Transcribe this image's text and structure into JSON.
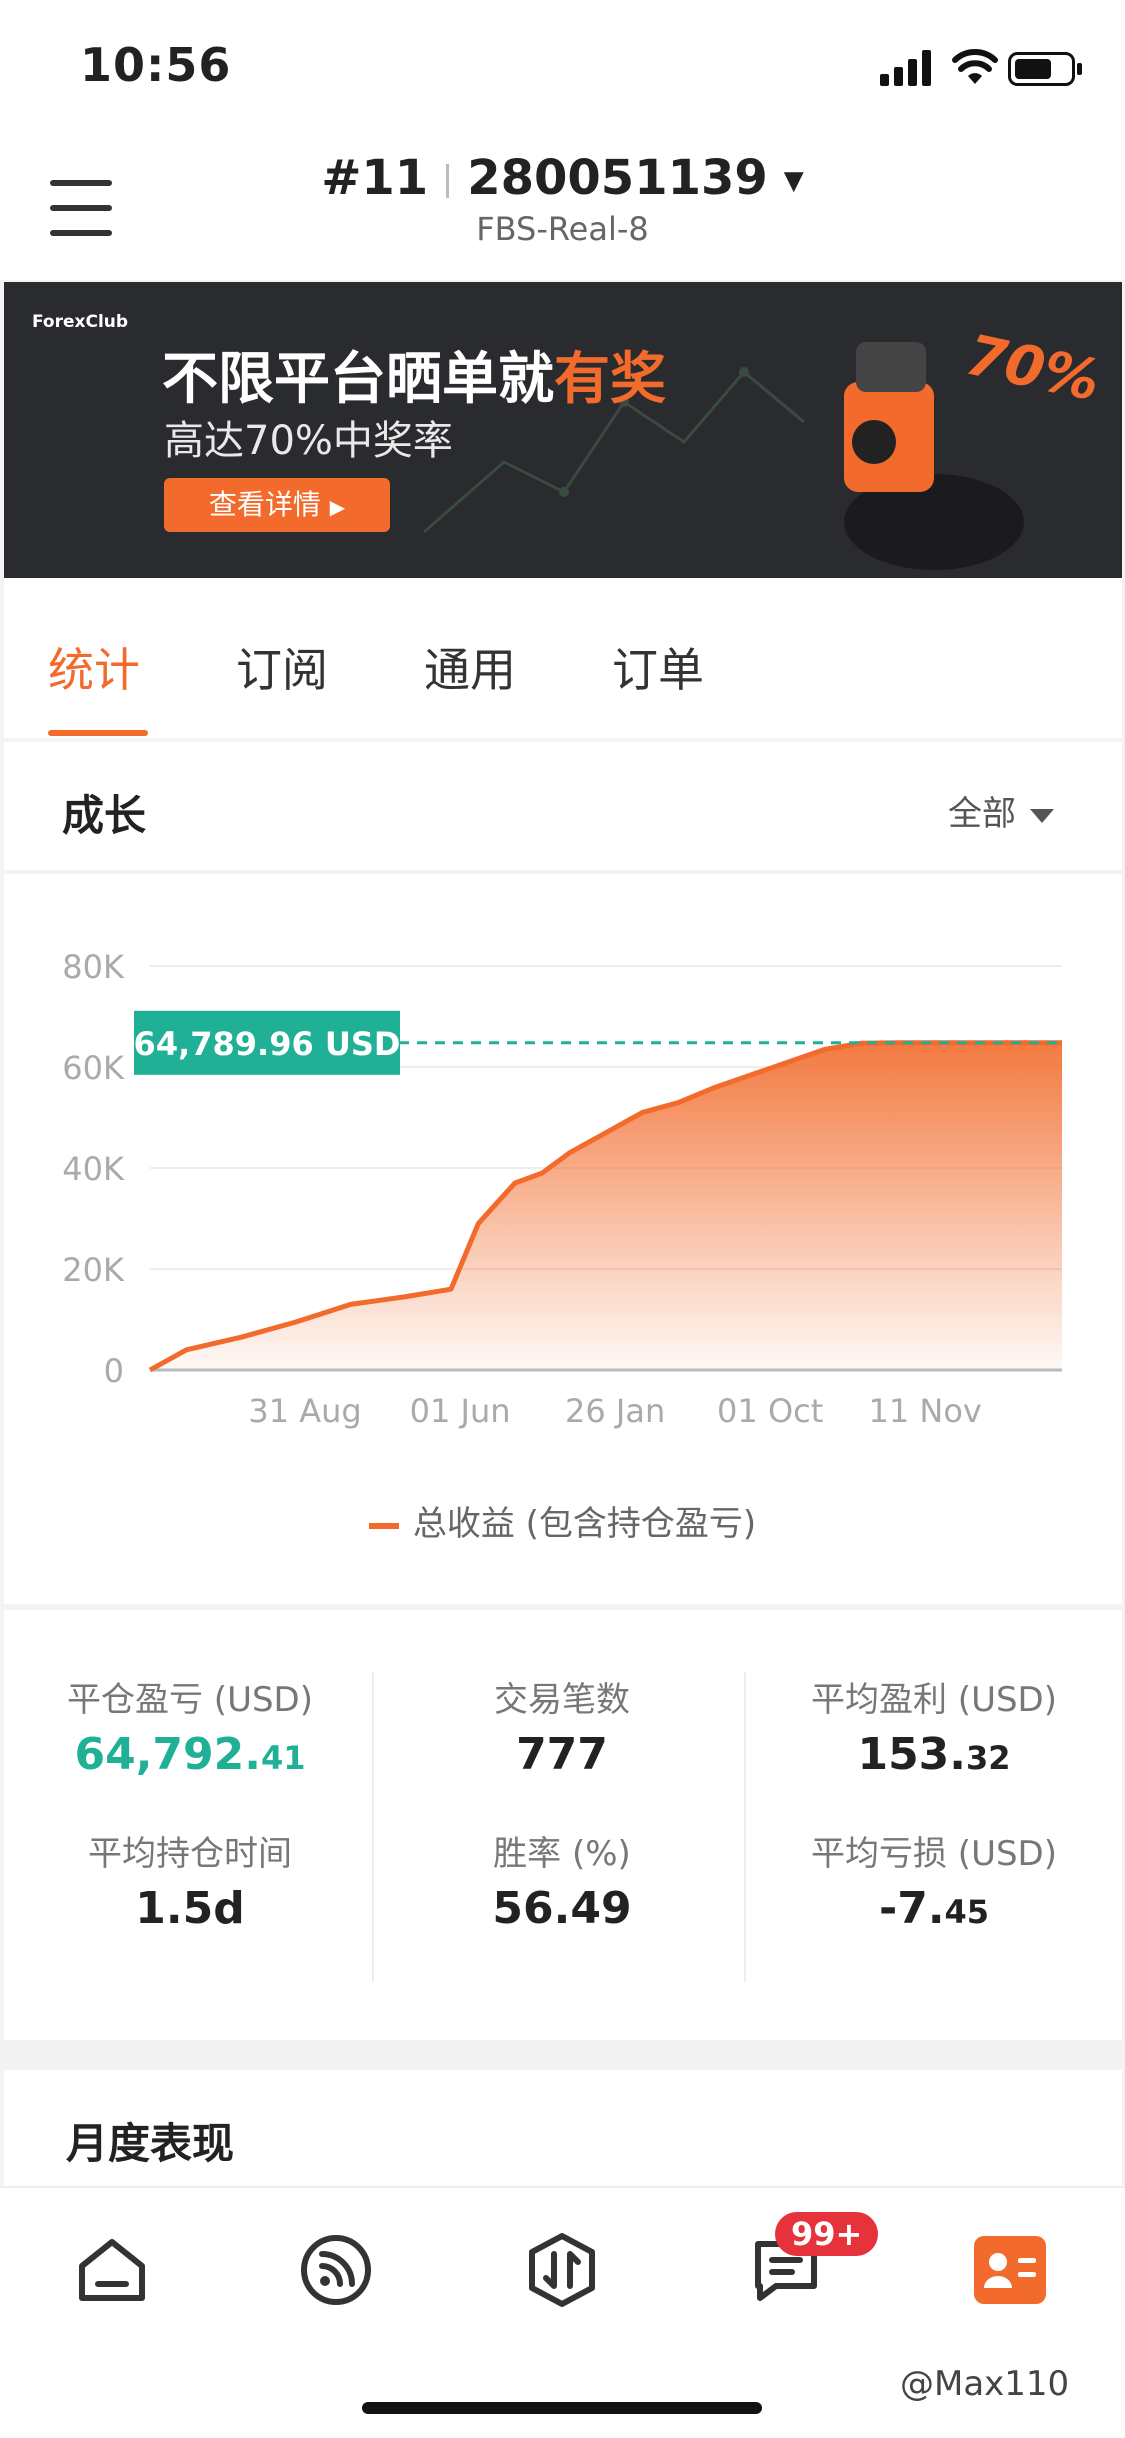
{
  "status_bar": {
    "time": "10:56"
  },
  "header": {
    "account_index": "#11",
    "account_number": "280051139",
    "server": "FBS-Real-8"
  },
  "banner": {
    "logo_text": "ForexClub",
    "title_prefix": "不限平台晒单就",
    "title_highlight": "有奖",
    "subtitle": "高达70%中奖率",
    "button_label": "查看详情",
    "percent_badge": "70%"
  },
  "tabs": [
    {
      "label": "统计"
    },
    {
      "label": "订阅"
    },
    {
      "label": "通用"
    },
    {
      "label": "订单"
    }
  ],
  "growth": {
    "title": "成长",
    "filter": "全部",
    "current_value_label": "64,789.96 USD",
    "legend": "总收益 (包含持仓盈亏)"
  },
  "chart_data": {
    "type": "area",
    "y_ticks": [
      "80K",
      "60K",
      "40K",
      "20K",
      "0"
    ],
    "x_ticks": [
      "31 Aug",
      "01 Jun",
      "26 Jan",
      "01 Oct",
      "11 Nov"
    ],
    "ylim": [
      0,
      80000
    ],
    "series": [
      {
        "name": "总收益 (包含持仓盈亏)",
        "color": "#f26b2c",
        "x": [
          0,
          0.04,
          0.1,
          0.16,
          0.22,
          0.28,
          0.33,
          0.36,
          0.37,
          0.38,
          0.4,
          0.43,
          0.46,
          0.5,
          0.54,
          0.58,
          0.62,
          0.66,
          0.7,
          0.74,
          0.78,
          0.82,
          0.86,
          0.9,
          0.95,
          1.0
        ],
        "values": [
          0,
          4000,
          6500,
          9500,
          13000,
          14500,
          16000,
          29000,
          31000,
          33000,
          37000,
          39000,
          43000,
          47000,
          51000,
          53000,
          56000,
          58500,
          61000,
          63500,
          64700,
          64790,
          64790,
          64790,
          64790,
          64790
        ]
      }
    ],
    "reference_value": 64789.96
  },
  "stats": [
    {
      "label": "平仓盈亏 (USD)",
      "int": "64,792.",
      "dec": "41",
      "green": true
    },
    {
      "label": "交易笔数",
      "int": "777",
      "dec": "",
      "green": false
    },
    {
      "label": "平均盈利 (USD)",
      "int": "153.",
      "dec": "32",
      "green": false
    },
    {
      "label": "平均持仓时间",
      "int": "1.5d",
      "dec": "",
      "green": false
    },
    {
      "label": "胜率 (%)",
      "int": "56.49",
      "dec": "",
      "green": false
    },
    {
      "label": "平均亏损 (USD)",
      "int": "-7.",
      "dec": "45",
      "green": false
    }
  ],
  "monthly": {
    "title": "月度表现"
  },
  "nav": {
    "badge": "99+"
  },
  "watermark": "@Max110"
}
